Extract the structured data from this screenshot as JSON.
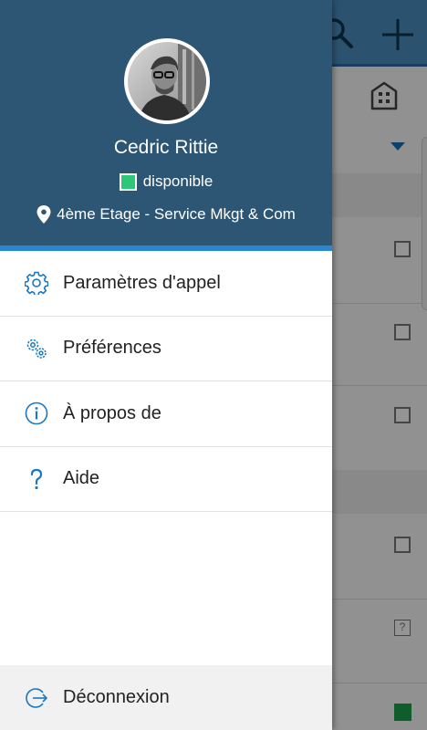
{
  "user": {
    "name": "Cedric Rittie",
    "status_text": "disponible",
    "status_color": "#2ec77a",
    "location": "4ème Etage - Service Mkgt & Com"
  },
  "menu": {
    "items": [
      {
        "label": "Paramètres d'appel",
        "icon": "gear-icon"
      },
      {
        "label": "Préférences",
        "icon": "gears-icon"
      },
      {
        "label": "À propos de",
        "icon": "info-icon"
      },
      {
        "label": "Aide",
        "icon": "help-icon"
      }
    ],
    "logout_label": "Déconnexion"
  },
  "colors": {
    "header_bg": "#2d5674",
    "accent": "#2a86cf",
    "icon": "#1a78c2"
  },
  "background": {
    "help_mark": "?"
  }
}
